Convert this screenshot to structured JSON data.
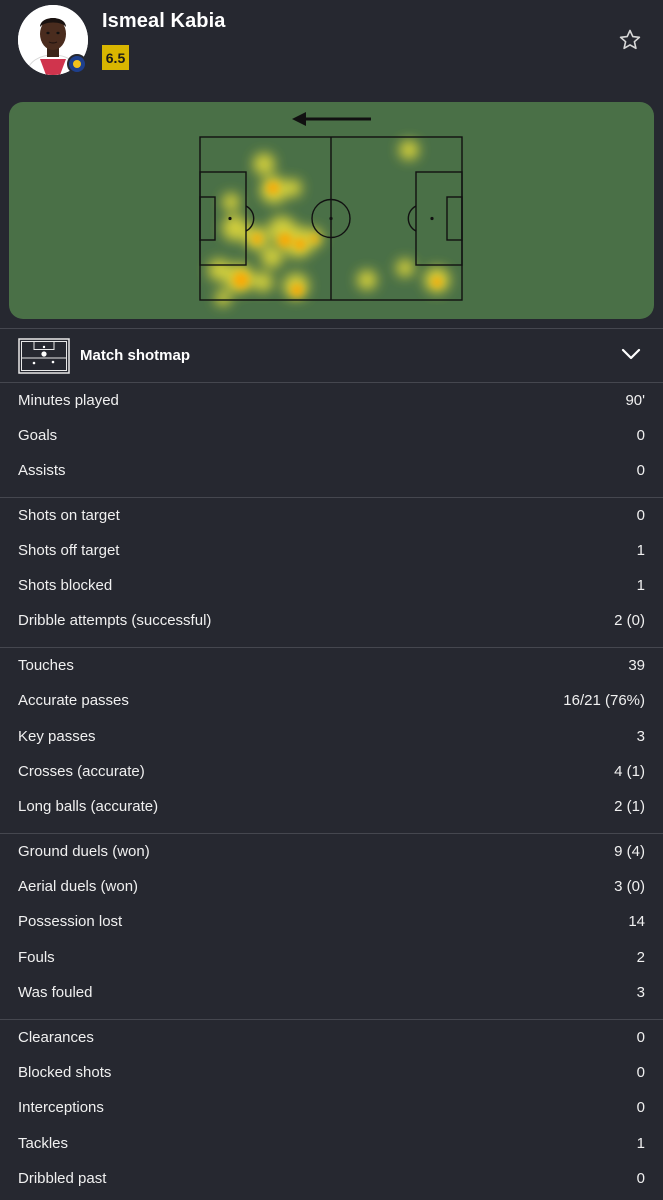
{
  "player": {
    "name": "Ismeal Kabia",
    "rating": "6.5"
  },
  "colors": {
    "background": "#262830",
    "pitch": "#4a7047",
    "rating_badge": "#d9b600",
    "heat_core": "#ffb000",
    "heat_outer": "#f2e33a"
  },
  "icons": {
    "favorite": "star-outline-icon",
    "shotmap": "pitch-icon",
    "expand": "chevron-down-icon",
    "direction": "arrow-left-icon"
  },
  "shotmap": {
    "label": "Match shotmap"
  },
  "stats": {
    "general": [
      {
        "label": "Minutes played",
        "value": "90'"
      },
      {
        "label": "Goals",
        "value": "0"
      },
      {
        "label": "Assists",
        "value": "0"
      }
    ],
    "attack": [
      {
        "label": "Shots on target",
        "value": "0"
      },
      {
        "label": "Shots off target",
        "value": "1"
      },
      {
        "label": "Shots blocked",
        "value": "1"
      },
      {
        "label": "Dribble attempts (successful)",
        "value": "2 (0)"
      }
    ],
    "passing": [
      {
        "label": "Touches",
        "value": "39"
      },
      {
        "label": "Accurate passes",
        "value": "16/21 (76%)"
      },
      {
        "label": "Key passes",
        "value": "3"
      },
      {
        "label": "Crosses (accurate)",
        "value": "4 (1)"
      },
      {
        "label": "Long balls (accurate)",
        "value": "2 (1)"
      }
    ],
    "duels": [
      {
        "label": "Ground duels (won)",
        "value": "9 (4)"
      },
      {
        "label": "Aerial duels (won)",
        "value": "3 (0)"
      },
      {
        "label": "Possession lost",
        "value": "14"
      },
      {
        "label": "Fouls",
        "value": "2"
      },
      {
        "label": "Was fouled",
        "value": "3"
      }
    ],
    "defending": [
      {
        "label": "Clearances",
        "value": "0"
      },
      {
        "label": "Blocked shots",
        "value": "0"
      },
      {
        "label": "Interceptions",
        "value": "0"
      },
      {
        "label": "Tackles",
        "value": "1"
      },
      {
        "label": "Dribbled past",
        "value": "0"
      }
    ]
  }
}
